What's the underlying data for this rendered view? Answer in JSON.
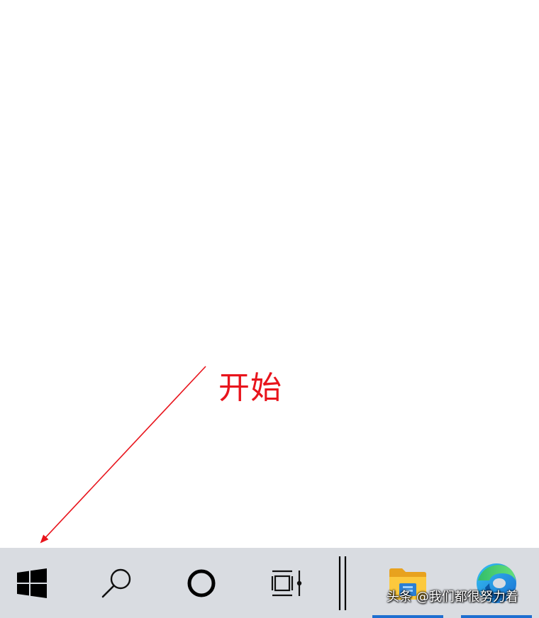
{
  "annotation": {
    "label": "开始",
    "color": "#e8141c"
  },
  "taskbar": {
    "background": "#d9dce1",
    "items": [
      {
        "name": "start",
        "icon": "windows-logo-icon",
        "active": false
      },
      {
        "name": "search",
        "icon": "search-icon",
        "active": false
      },
      {
        "name": "cortana",
        "icon": "cortana-ring-icon",
        "active": false
      },
      {
        "name": "task-view",
        "icon": "task-view-icon",
        "active": false
      },
      {
        "name": "file-explorer",
        "icon": "folder-icon",
        "active": true
      },
      {
        "name": "edge",
        "icon": "edge-browser-icon",
        "active": true
      }
    ],
    "active_indicator_color": "#1e6fd0"
  },
  "watermark": {
    "text": "头条 @我们都很努力着"
  }
}
